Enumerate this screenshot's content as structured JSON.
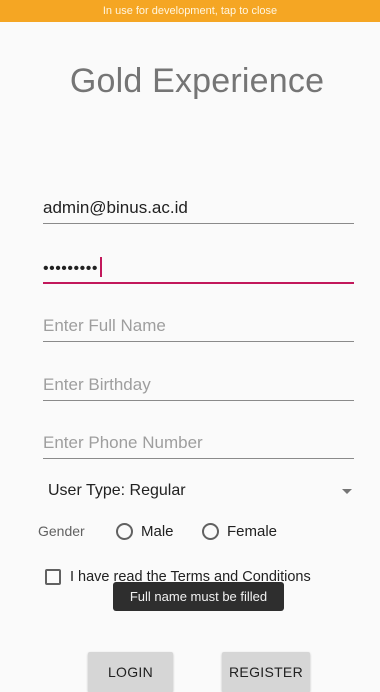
{
  "dev_banner": "In use for development, tap to close",
  "title": "Gold Experience",
  "form": {
    "email_value": "admin@binus.ac.id",
    "password_value": "•••••••••",
    "fullname_placeholder": "Enter Full Name",
    "birthday_placeholder": "Enter Birthday",
    "phone_placeholder": "Enter Phone Number",
    "user_type": "User Type: Regular",
    "gender_label": "Gender",
    "gender_male": "Male",
    "gender_female": "Female",
    "terms_label": "I have read the Terms and Conditions"
  },
  "toast": "Full name must be filled",
  "buttons": {
    "login": "LOGIN",
    "register": "REGISTER"
  },
  "colors": {
    "banner": "#f5a623",
    "accent": "#c2185b"
  }
}
